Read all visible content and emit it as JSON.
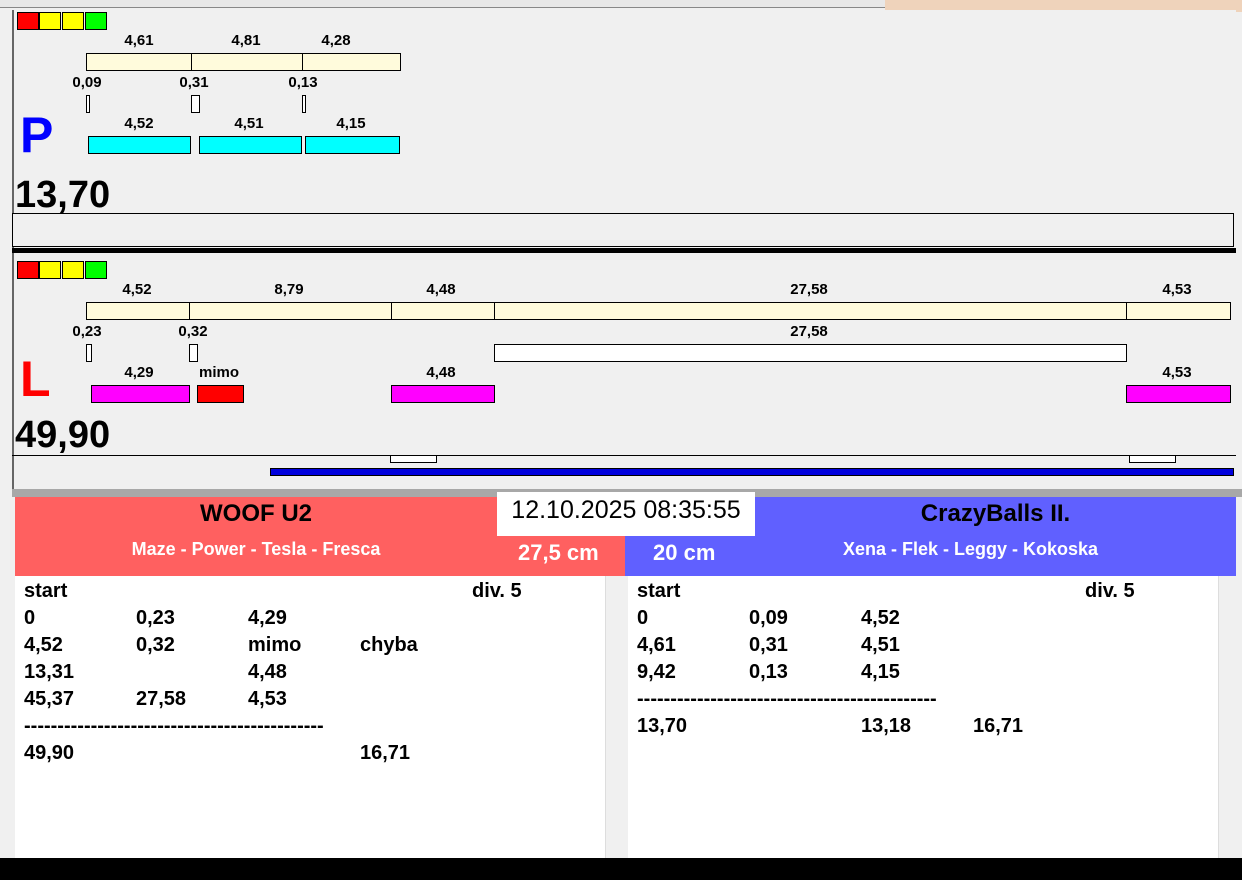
{
  "top": {
    "letter": "P",
    "total": "13,70",
    "row1": [
      "4,61",
      "4,81",
      "4,28"
    ],
    "row2": [
      "0,09",
      "0,31",
      "0,13"
    ],
    "row3": [
      "4,52",
      "4,51",
      "4,15"
    ]
  },
  "bottom": {
    "letter": "L",
    "total": "49,90",
    "row1": [
      "4,52",
      "8,79",
      "4,48",
      "27,58",
      "4,53"
    ],
    "row2": [
      "0,23",
      "0,32",
      "27,58"
    ],
    "row3": [
      "4,29",
      "mimo",
      "4,48",
      "4,53"
    ]
  },
  "datetime": "12.10.2025 08:35:55",
  "left_team": {
    "name": "WOOF U2",
    "dogs": "Maze - Power - Tesla - Fresca",
    "height": "27,5 cm",
    "color": "#ff6060",
    "header": [
      "start",
      "div.  5"
    ],
    "rows": [
      [
        "0",
        "0,23",
        "4,29",
        ""
      ],
      [
        "4,52",
        "0,32",
        "mimo",
        "chyba"
      ],
      [
        "13,31",
        "",
        "4,48",
        ""
      ],
      [
        "45,37",
        "27,58",
        "4,53",
        ""
      ]
    ],
    "separator": "---------------------------------------------",
    "totals": [
      "49,90",
      "",
      "",
      "16,71"
    ]
  },
  "right_team": {
    "name": "CrazyBalls II.",
    "dogs": "Xena - Flek - Leggy - Kokoska",
    "height": "20 cm",
    "color": "#6060ff",
    "header": [
      "start",
      "div.  5"
    ],
    "rows": [
      [
        "0",
        "0,09",
        "4,52",
        ""
      ],
      [
        "4,61",
        "0,31",
        "4,51",
        ""
      ],
      [
        "9,42",
        "0,13",
        "4,15",
        ""
      ]
    ],
    "separator": "---------------------------------------------",
    "totals": [
      "13,70",
      "",
      "13,18",
      "16,71"
    ]
  }
}
